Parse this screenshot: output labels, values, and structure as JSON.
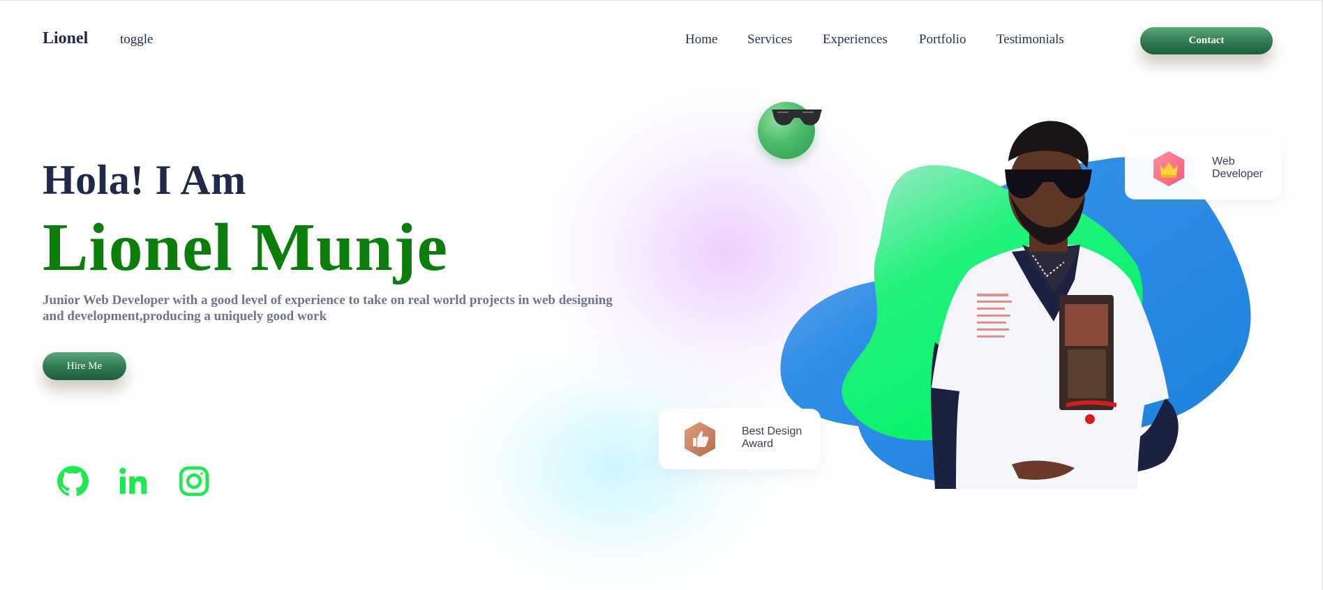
{
  "nav": {
    "logo": "Lionel",
    "toggle": "toggle",
    "links": [
      "Home",
      "Services",
      "Experiences",
      "Portfolio",
      "Testimonials"
    ],
    "contact_label": "Contact"
  },
  "hero": {
    "greeting": "Hola! I Am",
    "name": "Lionel Munje",
    "description_line1": "Junior Web Developer with a good level of experience to take on real world projects in web designing",
    "description_line2": "and development,producing a uniquely good work",
    "hire_label": "Hire Me"
  },
  "social": [
    {
      "icon": "github-icon"
    },
    {
      "icon": "linkedin-icon"
    },
    {
      "icon": "instagram-icon"
    }
  ],
  "badges": {
    "web": {
      "line1": "Web",
      "line2": "Developer",
      "icon": "crown-icon"
    },
    "award": {
      "line1": "Best Design",
      "line2": "Award",
      "icon": "thumbs-up-icon"
    }
  },
  "colors": {
    "brand_green": "#0b7d0b",
    "button_green": "#2f7a52",
    "social_green": "#1fe850",
    "navy": "#1f2a4a",
    "blob_blue": "#1e86e0",
    "blob_green": "#00f36a"
  }
}
